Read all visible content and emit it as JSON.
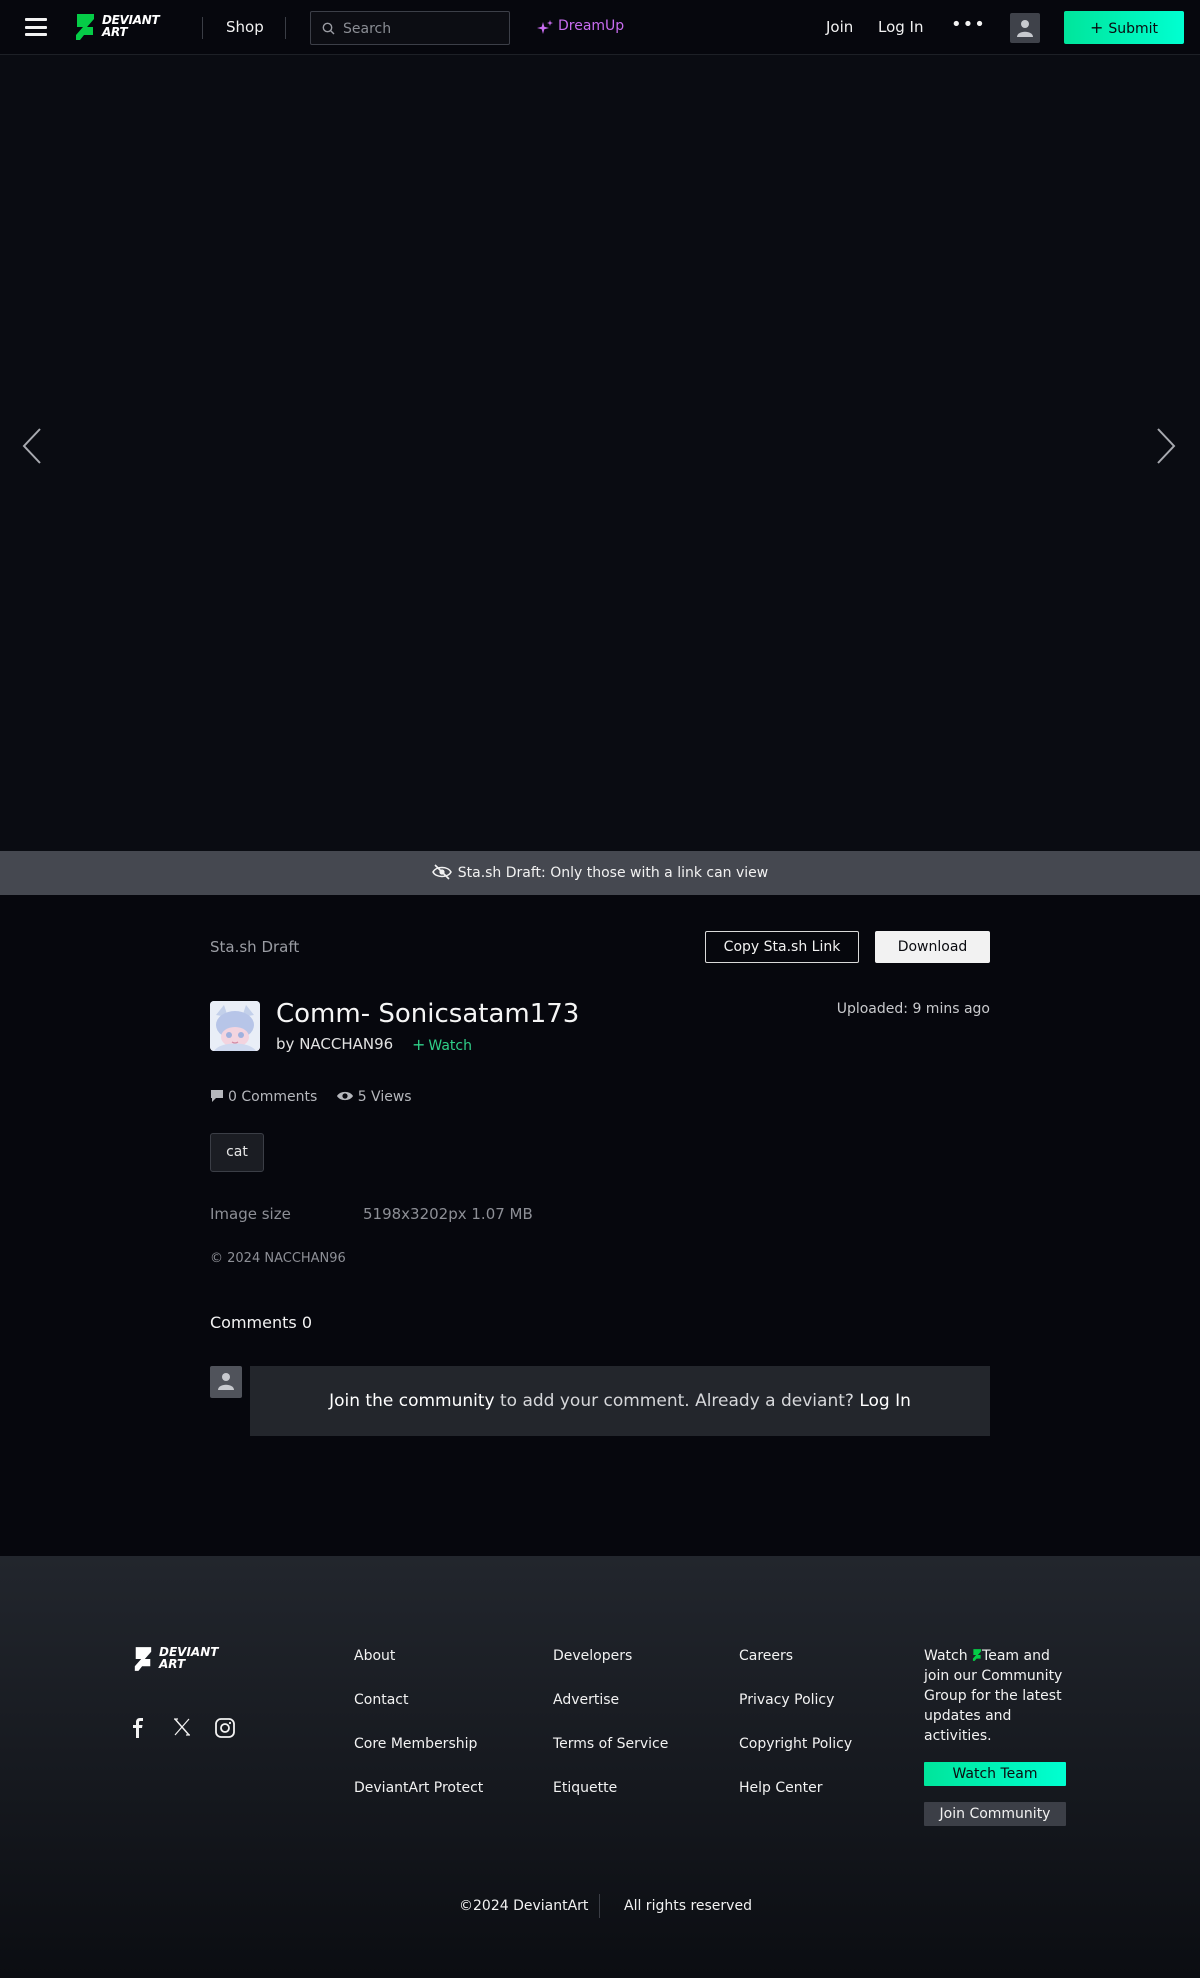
{
  "header": {
    "logo_line1": "DEVIANT",
    "logo_line2": "ART",
    "shop_label": "Shop",
    "search_placeholder": "Search",
    "dreamup_label": "DreamUp",
    "join_label": "Join",
    "login_label": "Log In",
    "more_label": "•••",
    "submit_label": "Submit"
  },
  "banner": {
    "text": "Sta.sh Draft: Only those with a link can view"
  },
  "deviation": {
    "stash_label": "Sta.sh Draft",
    "copy_link_label": "Copy Sta.sh Link",
    "download_label": "Download",
    "title": "Comm- Sonicsatam173",
    "by_prefix": "by",
    "author": "NACCHAN96",
    "watch_label": "Watch",
    "uploaded_label": "Uploaded:",
    "uploaded_value": "9 mins ago",
    "comments_count_label": "0 Comments",
    "views_label": "5 Views",
    "tags": [
      "cat"
    ],
    "image_size_label": "Image size",
    "image_size_value": "5198x3202px 1.07 MB",
    "copyright": "© 2024 NACCHAN96"
  },
  "comments": {
    "heading": "Comments 0",
    "join_highlight": "Join the community",
    "join_middle": " to add your comment. Already a deviant? ",
    "login_link": "Log In"
  },
  "footer": {
    "col1": [
      "About",
      "Contact",
      "Core Membership",
      "DeviantArt Protect"
    ],
    "col2": [
      "Developers",
      "Advertise",
      "Terms of Service",
      "Etiquette"
    ],
    "col3": [
      "Careers",
      "Privacy Policy",
      "Copyright Policy",
      "Help Center"
    ],
    "watch_text_1": "Watch",
    "watch_text_2": "Team and join our Community Group for the latest updates and activities.",
    "watch_team_label": "Watch Team",
    "join_community_label": "Join Community",
    "copyright": "©2024 DeviantArt",
    "rights": "All rights reserved",
    "social": [
      "facebook-icon",
      "x-icon",
      "instagram-icon"
    ]
  },
  "colors": {
    "accent_green": "#00e59b",
    "accent_cyan": "#00ffd1",
    "dreamup_purple": "#c86cf0",
    "watch_green": "#2fcf88",
    "background": "#06070d"
  }
}
